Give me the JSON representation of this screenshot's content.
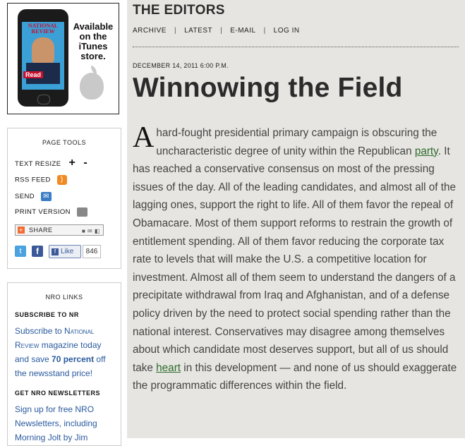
{
  "ad": {
    "line1": "Available",
    "line2": "on the",
    "line3": "iTunes",
    "line4": "store.",
    "phone_logo": "NATIONAL REVIEW",
    "phone_badge": "Read"
  },
  "page_tools": {
    "title": "PAGE TOOLS",
    "text_resize": "TEXT RESIZE",
    "plus": "+",
    "minus": "-",
    "rss_feed": "RSS FEED",
    "send": "SEND",
    "print_version": "PRINT VERSION",
    "share": "SHARE",
    "like_label": "Like",
    "like_count": "846",
    "icons": [
      "rss-icon",
      "mail-icon",
      "printer-icon",
      "twitter-icon",
      "facebook-icon"
    ]
  },
  "nro_links": {
    "title": "NRO LINKS",
    "subscribe_head": "SUBSCRIBE TO NR",
    "subscribe_text_1": "Subscribe to ",
    "subscribe_text_brand": "National Review",
    "subscribe_text_2": " magazine today and save ",
    "subscribe_text_bold": "70 percent",
    "subscribe_text_3": " off the newsstand price!",
    "newsletters_head": "GET NRO NEWSLETTERS",
    "newsletters_text": "Sign up for free NRO Newsletters, including Morning Jolt by Jim"
  },
  "main": {
    "section_title": "THE EDITORS",
    "nav": [
      "ARCHIVE",
      "LATEST",
      "E-MAIL",
      "LOG IN"
    ],
    "nav_separator": "|",
    "dateline": "DECEMBER 14, 2011 6:00 P.M.",
    "headline": "Winnowing the Field",
    "dropcap": "A",
    "body_1": " hard-fought presidential primary campaign is obscuring the uncharacteristic degree of unity within the Republican ",
    "link_1": "party",
    "body_2": ". It has reached a conservative consensus on most of the pressing issues of the day. All of the leading candidates, and almost all of the lagging ones, support the right to life. All of them favor the repeal of Obamacare. Most of them support reforms to restrain the growth of entitlement spending. All of them favor reducing the corporate tax rate to levels that will make the U.S. a competitive location for investment. Almost all of them seem to understand the dangers of a precipitate withdrawal from Iraq and Afghanistan, and of a defense policy driven by the need to protect social spending rather than the national interest. Conservatives may disagree among themselves about which candidate most deserves support, but all of us should take ",
    "link_2": "heart",
    "body_3": " in this development — and none of us should exaggerate the programmatic differences within the field."
  }
}
